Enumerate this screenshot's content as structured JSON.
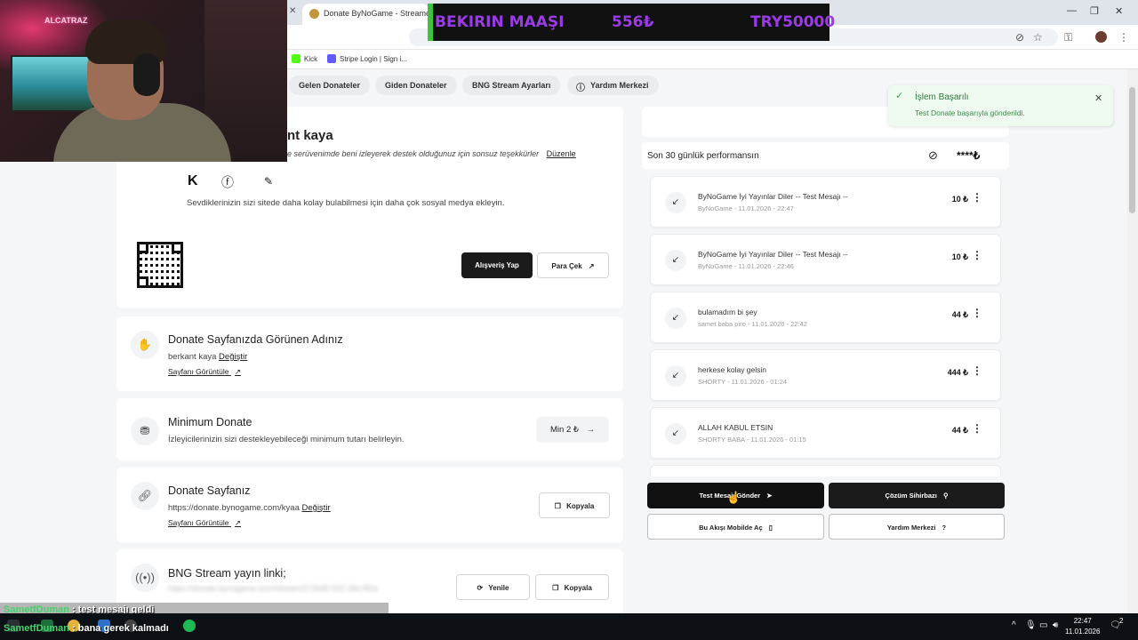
{
  "browser": {
    "tab_title": "Donate ByNoGame - Streamer",
    "bookmarks": [
      "Kick",
      "Stripe Login | Sign i..."
    ]
  },
  "banner": {
    "title": "BEKIRIN MAAŞI",
    "current": "556₺",
    "goal": "TRY50000"
  },
  "nav": {
    "tabs": [
      "Gelen Donateler",
      "Giden Donateler",
      "BNG Stream Ayarları",
      "Yardım Merkezi"
    ]
  },
  "profile": {
    "name": "nt kaya",
    "description": "e serüvenimde beni izleyerek destek olduğunuz için sonsuz teşekkürler",
    "edit_label": "Düzenle",
    "social_note": "Sevdiklerinizin sizi sitede daha kolay bulabilmesi için daha çok sosyal medya ekleyin.",
    "shop_button": "Alışveriş Yap",
    "withdraw_button": "Para Çek"
  },
  "display_name": {
    "title": "Donate Sayfanızda Görünen Adınız",
    "value": "berkant kaya",
    "change_label": "Değiştir",
    "view_label": "Sayfanı Görüntüle"
  },
  "min_donate": {
    "title": "Minimum Donate",
    "description": "İzleyicilerinizin sizi destekleyebileceği minimum tutarı belirleyin.",
    "button": "Min 2 ₺"
  },
  "donate_page": {
    "title": "Donate Sayfanız",
    "url": "https://donate.bynogame.com/kyaa",
    "change_label": "Değiştir",
    "view_label": "Sayfanı Görüntüle",
    "copy_button": "Kopyala"
  },
  "stream_link": {
    "title": "BNG Stream yayın linki;",
    "url_blurred": "https://donate.bynogame.com/stream/2736d5  f2f2  28a  f82a",
    "refresh_button": "Yenile",
    "copy_button": "Kopyala"
  },
  "performance": {
    "label": "Son 30 günlük performansın",
    "masked_value": "****₺"
  },
  "donations": [
    {
      "message": "ByNoGame İyi Yayınlar Diler -- Test Mesajı --",
      "sender": "ByNoGame",
      "date": "11.01.2026 - 22:47",
      "amount": "10 ₺"
    },
    {
      "message": "ByNoGame İyi Yayınlar Diler -- Test Mesajı --",
      "sender": "ByNoGame",
      "date": "11.01.2026 - 22:46",
      "amount": "10 ₺"
    },
    {
      "message": "bulamadım bi şey",
      "sender": "samet baba piro",
      "date": "11.01.2026 - 22:42",
      "amount": "44 ₺"
    },
    {
      "message": "herkese kolay gelsin",
      "sender": "SHORTY",
      "date": "11.01.2026 - 01:24",
      "amount": "444 ₺"
    },
    {
      "message": "ALLAH KABUL ETSIN",
      "sender": "SHORTY BABA",
      "date": "11.01.2026 - 01:15",
      "amount": "44 ₺"
    }
  ],
  "actions": {
    "test_message": "Test Mesajı Gönder",
    "solution_wizard": "Çözüm Sihirbazı",
    "mobile_flow": "Bu Akışı Mobilde Aç",
    "help_center": "Yardım Merkezi"
  },
  "toast": {
    "title": "İşlem Başarılı",
    "message": "Test Donate başarıyla gönderildi."
  },
  "webcam": {
    "sign": "ALCATRAZ"
  },
  "chat": [
    {
      "user": "SametfDuman",
      "text": ": test mesajı geldi"
    },
    {
      "user": "SametfDuman",
      "text": ": bana gerek kalmadı"
    }
  ],
  "taskbar": {
    "time": "22:47",
    "date": "11.01.2026",
    "notifications": "2"
  },
  "colors": {
    "banner_text": "#9b3be8",
    "banner_accent": "#3cc43c",
    "primary_button": "#1b1b1b",
    "toast_bg": "#eefaef",
    "chat_user": "#47d16c"
  }
}
